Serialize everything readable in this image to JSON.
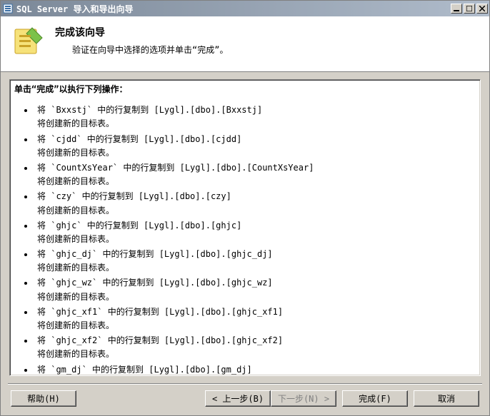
{
  "window": {
    "title": "SQL Server 导入和导出向导"
  },
  "header": {
    "title": "完成该向导",
    "subtitle": "验证在向导中选择的选项并单击“完成”。"
  },
  "content": {
    "heading": "单击“完成”以执行下列操作：",
    "create_text": "将创建新的目标表。",
    "operations": [
      {
        "line": "将 `Bxxstj` 中的行复制到 [Lygl].[dbo].[Bxxstj]"
      },
      {
        "line": "将 `cjdd` 中的行复制到 [Lygl].[dbo].[cjdd]"
      },
      {
        "line": "将 `CountXsYear` 中的行复制到 [Lygl].[dbo].[CountXsYear]"
      },
      {
        "line": "将 `czy` 中的行复制到 [Lygl].[dbo].[czy]"
      },
      {
        "line": "将 `ghjc` 中的行复制到 [Lygl].[dbo].[ghjc]"
      },
      {
        "line": "将 `ghjc_dj` 中的行复制到 [Lygl].[dbo].[ghjc_dj]"
      },
      {
        "line": "将 `ghjc_wz` 中的行复制到 [Lygl].[dbo].[ghjc_wz]"
      },
      {
        "line": "将 `ghjc_xf1` 中的行复制到 [Lygl].[dbo].[ghjc_xf1]"
      },
      {
        "line": "将 `ghjc_xf2` 中的行复制到 [Lygl].[dbo].[ghjc_xf2]"
      },
      {
        "line": "将 `gm_dj` 中的行复制到 [Lygl].[dbo].[gm_dj]"
      }
    ]
  },
  "buttons": {
    "help": "帮助(H)",
    "back": "< 上一步(B)",
    "next": "下一步(N) >",
    "finish": "完成(F)",
    "cancel": "取消"
  }
}
